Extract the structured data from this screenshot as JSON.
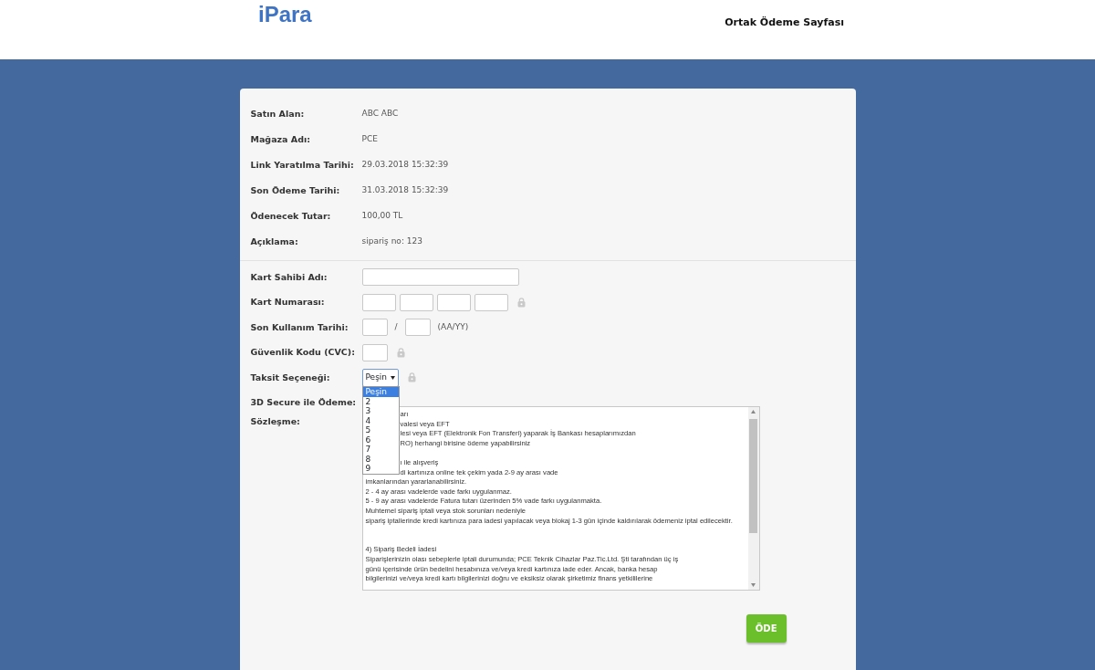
{
  "header": {
    "logo": "iPara",
    "title": "Ortak Ödeme Sayfası"
  },
  "summary": [
    {
      "label": "Satın Alan:",
      "value": "ABC ABC"
    },
    {
      "label": "Mağaza Adı:",
      "value": "PCE"
    },
    {
      "label": "Link Yaratılma Tarihi:",
      "value": "29.03.2018 15:32:39"
    },
    {
      "label": "Son Ödeme Tarihi:",
      "value": "31.03.2018 15:32:39"
    },
    {
      "label": "Ödenecek Tutar:",
      "value": "100,00 TL"
    },
    {
      "label": "Açıklama:",
      "value": "sipariş no: 123"
    }
  ],
  "form": [
    {
      "kind": "text",
      "label": "Kart Sahibi Adı:"
    },
    {
      "kind": "card_number",
      "label": "Kart Numarası:",
      "help": true
    },
    {
      "kind": "expiry",
      "label": "Son Kullanım Tarihi:",
      "separator": "/",
      "hint": "(AA/YY)"
    },
    {
      "kind": "cvc",
      "label": "Güvenlik Kodu (CVC):",
      "help": true
    },
    {
      "kind": "select",
      "label": "Taksit Seçeneği:",
      "value": "Peşin",
      "help": true,
      "expanded": true,
      "options": [
        {
          "label": "Peşin",
          "selected": true
        },
        {
          "label": "2",
          "selected": false
        },
        {
          "label": "3",
          "selected": false
        },
        {
          "label": "4",
          "selected": false
        },
        {
          "label": "5",
          "selected": false
        },
        {
          "label": "6",
          "selected": false
        },
        {
          "label": "7",
          "selected": false
        },
        {
          "label": "8",
          "selected": false
        },
        {
          "label": "9",
          "selected": false
        }
      ]
    },
    {
      "kind": "blank",
      "label": "3D Secure ile Ödeme:"
    },
    {
      "kind": "agreement",
      "label": "Sözleşme:",
      "lines": [
        {
          "kind": "covered",
          "text": "arı"
        },
        {
          "kind": "covered",
          "text": "valesi veya EFT"
        },
        {
          "kind": "covered",
          "text": "lesi veya EFT (Elektronik Fon Transferi) yaparak İş Bankası hesaplarımızdan"
        },
        {
          "kind": "covered",
          "text": "RO) herhangi birisine ödeme yapabilirsiniz"
        },
        {
          "kind": "blank"
        },
        {
          "kind": "covered",
          "text": "ı ile alışveriş"
        },
        {
          "kind": "covered",
          "text": "di kartınıza online tek çekim yada 2-9 ay arası vade"
        },
        {
          "kind": "full",
          "text": "imkanlarından yararlanabilirsiniz."
        },
        {
          "kind": "full",
          "text": "2 - 4 ay arası vadelerde vade farkı uygulanmaz."
        },
        {
          "kind": "full",
          "text": "5 - 9 ay arası vadelerde Fatura tutarı üzerinden 5% vade farkı uygulanmakta."
        },
        {
          "kind": "full",
          "text": "Muhtemel sipariş iptali veya stok sorunları nedeniyle"
        },
        {
          "kind": "full",
          "text": "sipariş iptallerinde kredi kartınıza para iadesi yapılacak veya blokaj 1-3 gün içinde kaldırılarak ödemeniz iptal edilecektir."
        },
        {
          "kind": "blank"
        },
        {
          "kind": "blank"
        },
        {
          "kind": "full",
          "text": "4) Sipariş Bedeli İadesi"
        },
        {
          "kind": "full",
          "text": "Siparişlerinizin olası sebeplerle iptali durumunda; PCE Teknik Cihazlar Paz.Tic.Ltd. Şti tarafından üç iş"
        },
        {
          "kind": "full",
          "text": "günü içerisinde ürün bedelini hesabınıza ve/veya kredi kartınıza iade eder. Ancak, banka hesap"
        },
        {
          "kind": "full",
          "text": "bilgilerinizi ve/veya kredi kartı bilgilerinizi doğru ve eksiksiz olarak şirketimiz finans yetkililerine"
        }
      ]
    }
  ],
  "submit": "ÖDE"
}
